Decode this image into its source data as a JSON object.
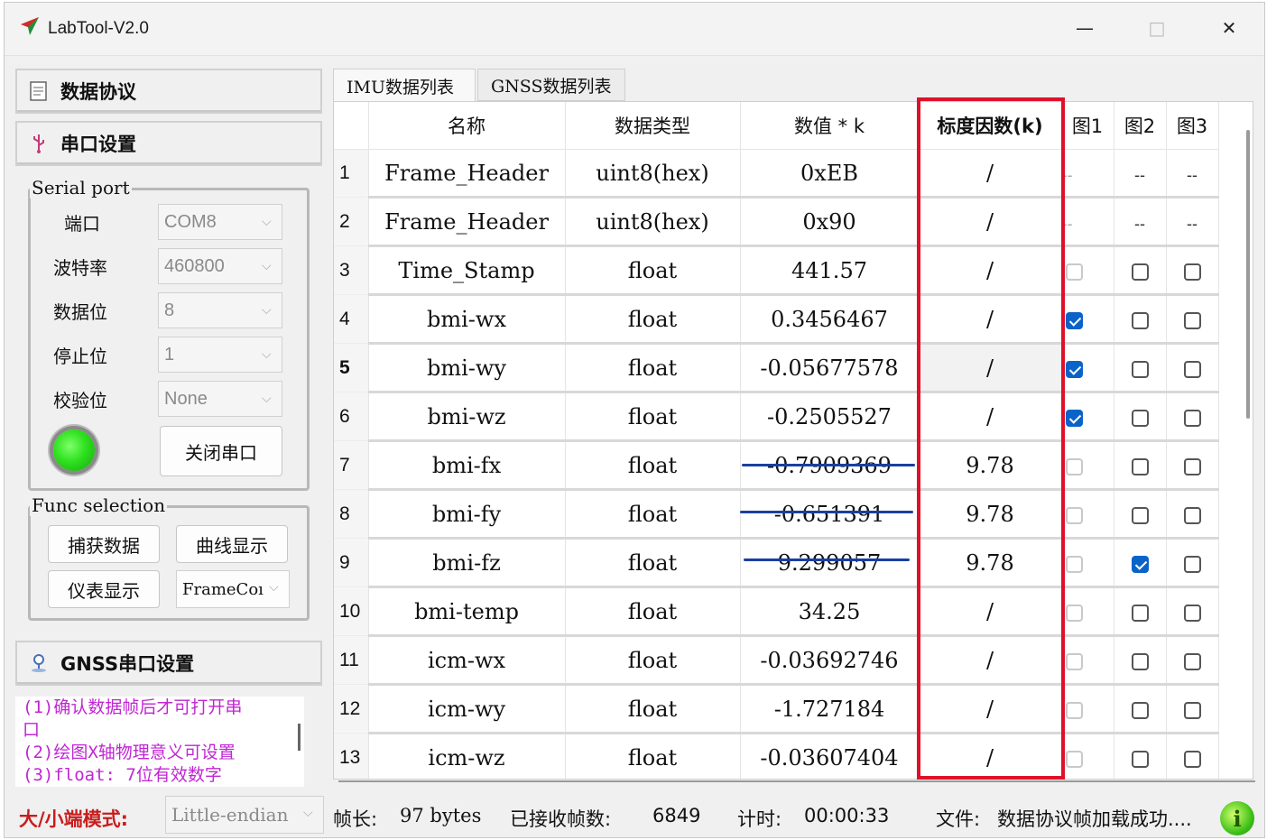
{
  "window": {
    "title": "LabTool-V2.0",
    "controls": {
      "minimize": "—",
      "maximize": "□",
      "close": "✕"
    }
  },
  "sidebar": {
    "data_protocol": "数据协议",
    "serial_settings": "串口设置",
    "gnss_settings": "GNSS串口设置",
    "serial_port": {
      "group_label": "Serial port",
      "port_label": "端口",
      "port_value": "COM8",
      "baud_label": "波特率",
      "baud_value": "460800",
      "databits_label": "数据位",
      "databits_value": "8",
      "stopbits_label": "停止位",
      "stopbits_value": "1",
      "parity_label": "校验位",
      "parity_value": "None",
      "close_button": "关闭串口",
      "status_color": "#2fe11f"
    },
    "func_selection": {
      "group_label": "Func selection",
      "capture_button": "捕获数据",
      "curve_button": "曲线显示",
      "gauge_button": "仪表显示",
      "mode_select": "FrameCoı"
    },
    "hints": [
      "(1)确认数据帧后才可打开串",
      "口",
      "(2)绘图X轴物理意义可设置",
      "(3)float: 7位有效数字"
    ]
  },
  "tabs": [
    "IMU数据列表",
    "GNSS数据列表"
  ],
  "table": {
    "headers": {
      "name": "名称",
      "type": "数据类型",
      "value": "数值 * k",
      "scale": "标度因数(k)",
      "plot1": "图1",
      "plot2": "图2",
      "plot3": "图3"
    },
    "rows": [
      {
        "num": "1",
        "name": "Frame_Header",
        "type": "uint8(hex)",
        "value": "0xEB",
        "scale": "/",
        "p1": "--",
        "p2": "--",
        "p3": "--"
      },
      {
        "num": "2",
        "name": "Frame_Header",
        "type": "uint8(hex)",
        "value": "0x90",
        "scale": "/",
        "p1": "--",
        "p2": "--",
        "p3": "--"
      },
      {
        "num": "3",
        "name": "Time_Stamp",
        "type": "float",
        "value": "441.57",
        "scale": "/",
        "p1": "off-disabled",
        "p2": "off",
        "p3": "off"
      },
      {
        "num": "4",
        "name": "bmi-wx",
        "type": "float",
        "value": "0.3456467",
        "scale": "/",
        "p1": "on",
        "p2": "off",
        "p3": "off"
      },
      {
        "num": "5",
        "name": "bmi-wy",
        "type": "float",
        "value": "-0.05677578",
        "scale": "/",
        "p1": "on",
        "p2": "off",
        "p3": "off"
      },
      {
        "num": "6",
        "name": "bmi-wz",
        "type": "float",
        "value": "-0.2505527",
        "scale": "/",
        "p1": "on",
        "p2": "off",
        "p3": "off"
      },
      {
        "num": "7",
        "name": "bmi-fx",
        "type": "float",
        "value": "-0.7909369",
        "scale": "9.78",
        "p1": "off-disabled",
        "p2": "off",
        "p3": "off"
      },
      {
        "num": "8",
        "name": "bmi-fy",
        "type": "float",
        "value": "-0.651391",
        "scale": "9.78",
        "p1": "off-disabled",
        "p2": "off",
        "p3": "off"
      },
      {
        "num": "9",
        "name": "bmi-fz",
        "type": "float",
        "value": "9.299057",
        "scale": "9.78",
        "p1": "off-disabled",
        "p2": "on",
        "p3": "off"
      },
      {
        "num": "10",
        "name": "bmi-temp",
        "type": "float",
        "value": "34.25",
        "scale": "/",
        "p1": "off-disabled",
        "p2": "off",
        "p3": "off"
      },
      {
        "num": "11",
        "name": "icm-wx",
        "type": "float",
        "value": "-0.03692746",
        "scale": "/",
        "p1": "off-disabled",
        "p2": "off",
        "p3": "off"
      },
      {
        "num": "12",
        "name": "icm-wy",
        "type": "float",
        "value": "-1.727184",
        "scale": "/",
        "p1": "off-disabled",
        "p2": "off",
        "p3": "off"
      },
      {
        "num": "13",
        "name": "icm-wz",
        "type": "float",
        "value": "-0.03607404",
        "scale": "/",
        "p1": "off-disabled",
        "p2": "off",
        "p3": "off"
      }
    ]
  },
  "status": {
    "endian_label": "大/小端模式:",
    "endian_value": "Little-endian",
    "frame_len_label": "帧长:",
    "frame_len_value": "97  bytes",
    "received_label": "已接收帧数:",
    "received_value": "6849",
    "timer_label": "计时:",
    "timer_value": "00:00:33",
    "file_label": "文件:",
    "file_value": "数据协议帧加载成功...."
  },
  "colors": {
    "highlight_box": "#e0102a",
    "underline": "#1a3fa0",
    "checkbox_checked": "#0a63c9",
    "hint_text": "#c026d3",
    "endian_label": "#c81e1e"
  }
}
